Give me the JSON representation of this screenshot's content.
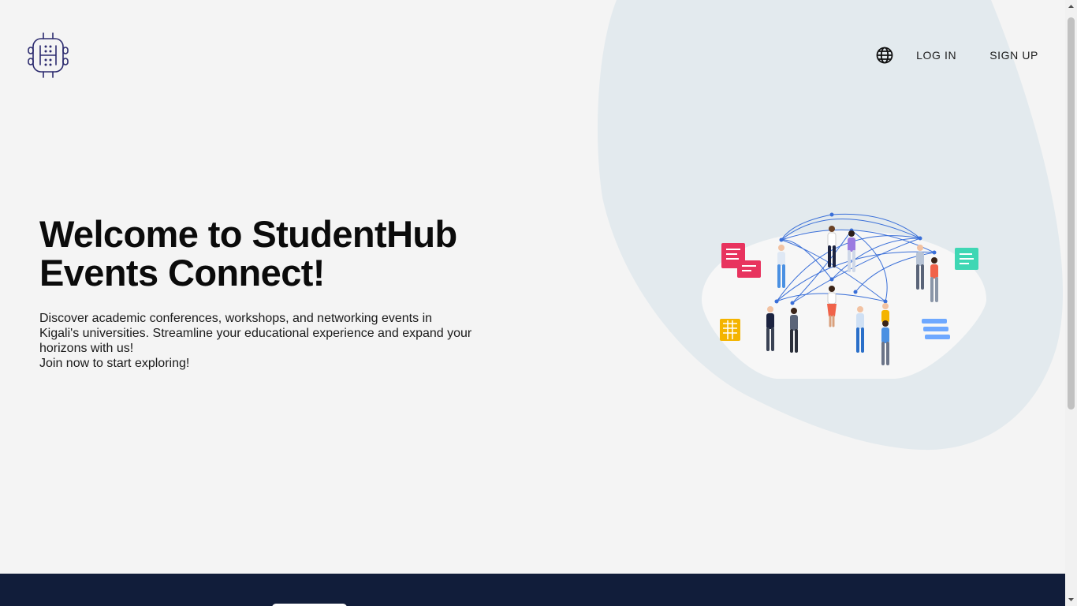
{
  "app": {
    "name": "StudentHub Events Connect"
  },
  "header": {
    "logo_icon": "studenthub-logo-icon",
    "language_icon": "globe-icon",
    "login_label": "LOG IN",
    "signup_label": "SIGN UP"
  },
  "hero": {
    "title_line1": "Welcome to StudentHub",
    "title_line2": "Events Connect!",
    "description": "Discover academic conferences, workshops, and networking events in Kigali's universities. Streamline your educational experience and expand your horizons with us!",
    "cta_text": "Join now to start exploring!"
  },
  "illustration": {
    "icon": "networking-people-illustration"
  },
  "colors": {
    "background": "#f4f4f4",
    "blob": "#e3eaee",
    "footer": "#111d3a",
    "logo": "#2b2a6e",
    "network_line": "#3a6fd8"
  }
}
